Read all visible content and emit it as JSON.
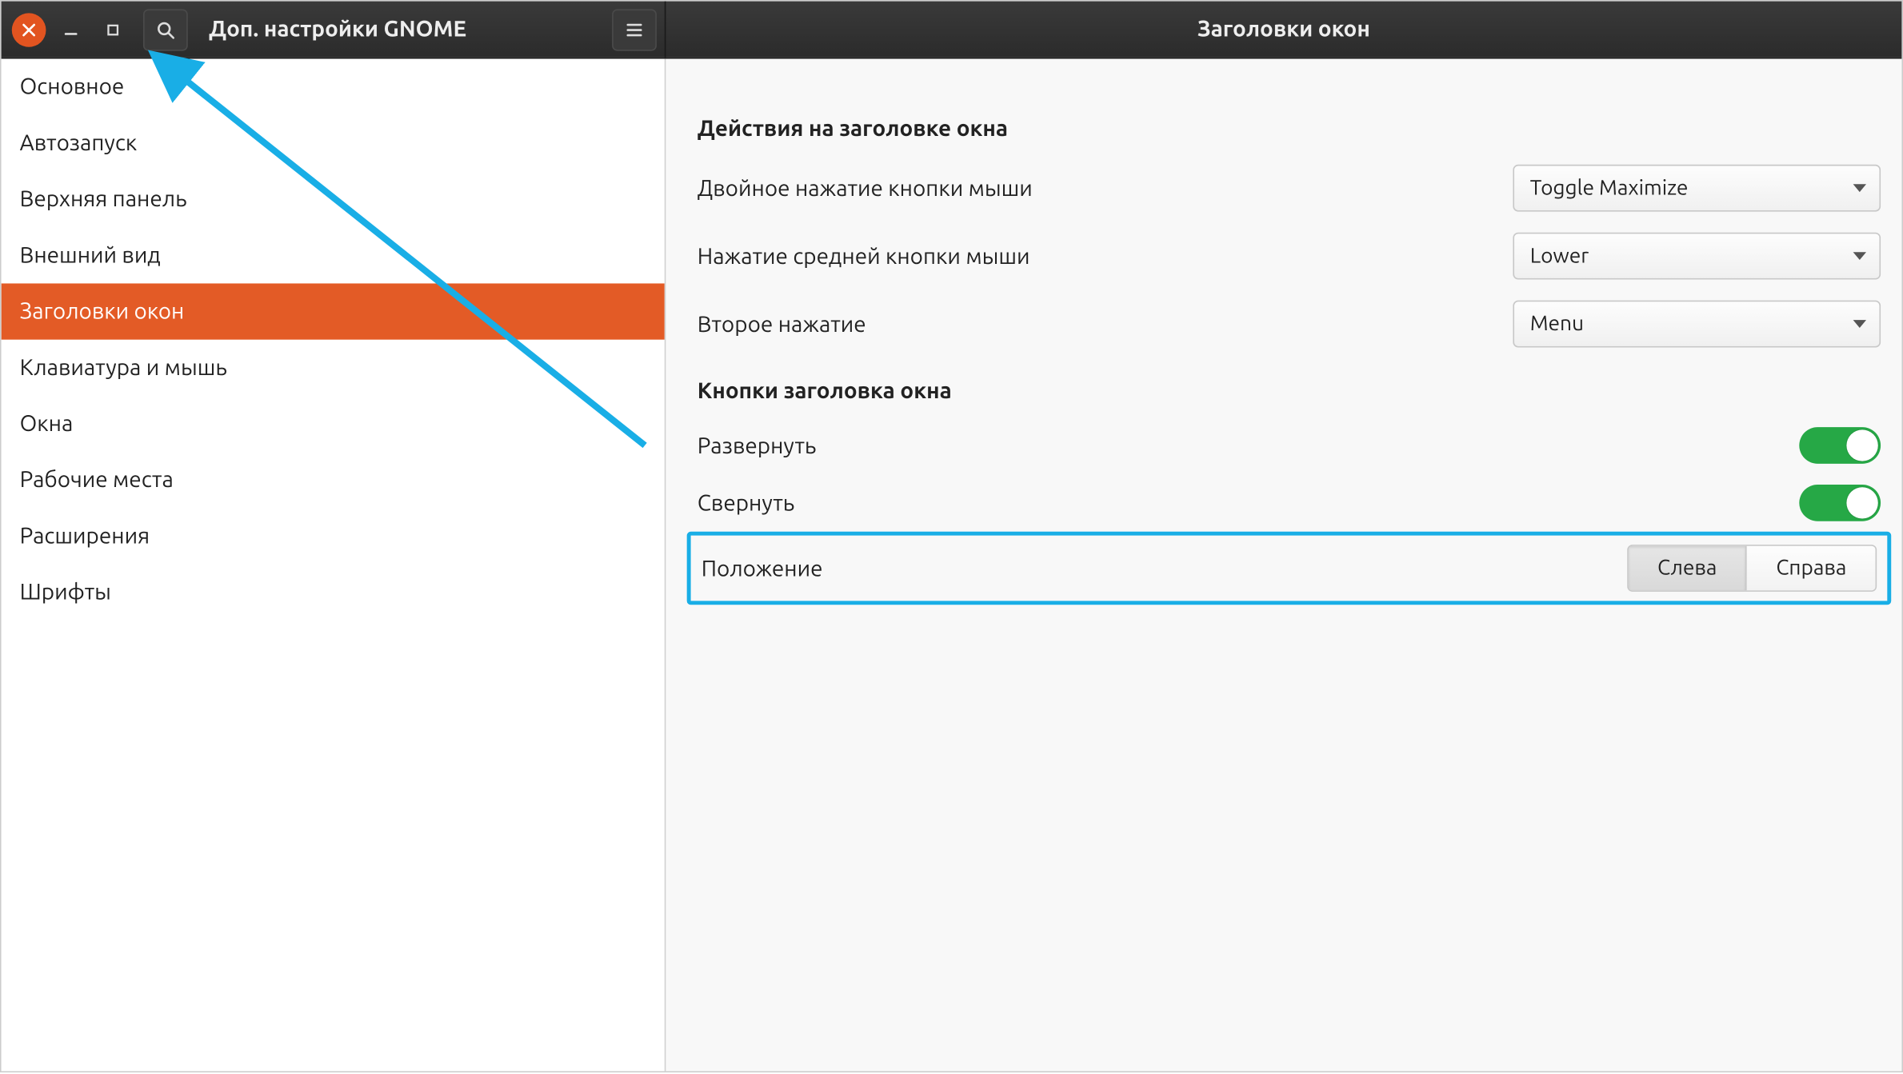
{
  "header": {
    "app_title": "Доп. настройки GNOME",
    "page_title": "Заголовки окон"
  },
  "sidebar": {
    "items": [
      {
        "label": "Основное",
        "active": false
      },
      {
        "label": "Автозапуск",
        "active": false
      },
      {
        "label": "Верхняя панель",
        "active": false
      },
      {
        "label": "Внешний вид",
        "active": false
      },
      {
        "label": "Заголовки окон",
        "active": true
      },
      {
        "label": "Клавиатура и мышь",
        "active": false
      },
      {
        "label": "Окна",
        "active": false
      },
      {
        "label": "Рабочие места",
        "active": false
      },
      {
        "label": "Расширения",
        "active": false
      },
      {
        "label": "Шрифты",
        "active": false
      }
    ]
  },
  "content": {
    "group_actions": {
      "title": "Действия на заголовке окна",
      "double_click": {
        "label": "Двойное нажатие кнопки мыши",
        "value": "Toggle Maximize"
      },
      "middle_click": {
        "label": "Нажатие средней кнопки мыши",
        "value": "Lower"
      },
      "secondary_click": {
        "label": "Второе нажатие",
        "value": "Menu"
      }
    },
    "group_buttons": {
      "title": "Кнопки заголовка окна",
      "maximize": {
        "label": "Развернуть",
        "on": true
      },
      "minimize": {
        "label": "Свернуть",
        "on": true
      },
      "placement": {
        "label": "Положение",
        "left": "Слева",
        "right": "Справа",
        "selected": "left"
      }
    }
  },
  "annotation": {
    "arrow_color": "#19aee6",
    "highlight_color": "#19aee6"
  }
}
